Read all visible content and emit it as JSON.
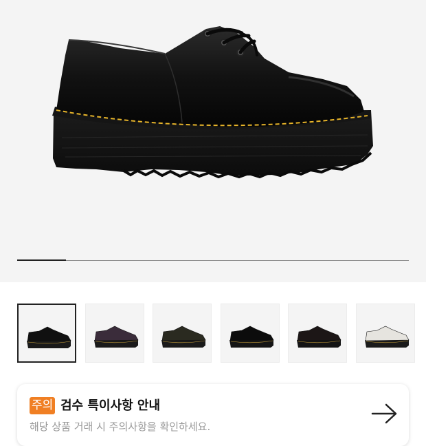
{
  "gallery": {
    "progress_fraction": 0.125,
    "thumbnails": [
      {
        "name": "thumb-black-smooth",
        "upper": "#101010",
        "sole": "#1a1a1a",
        "selected": true
      },
      {
        "name": "thumb-dark-purple",
        "upper": "#3a2c3a",
        "sole": "#1a1a1a",
        "selected": false
      },
      {
        "name": "thumb-dark-olive",
        "upper": "#2a2a20",
        "sole": "#1a1a1a",
        "selected": false
      },
      {
        "name": "thumb-black-patent-lace",
        "upper": "#0c0c0c",
        "sole": "#151515",
        "selected": false
      },
      {
        "name": "thumb-black-oxblood",
        "upper": "#1c1616",
        "sole": "#141414",
        "selected": false
      },
      {
        "name": "thumb-white",
        "upper": "#e6e4df",
        "sole": "#1a1a1a",
        "selected": false
      }
    ]
  },
  "notice": {
    "badge": "주의",
    "title": "검수 특이사항 안내",
    "subtitle": "해당 상품 거래 시 주의사항을 확인하세요.",
    "accent_color": "#f07f23"
  }
}
